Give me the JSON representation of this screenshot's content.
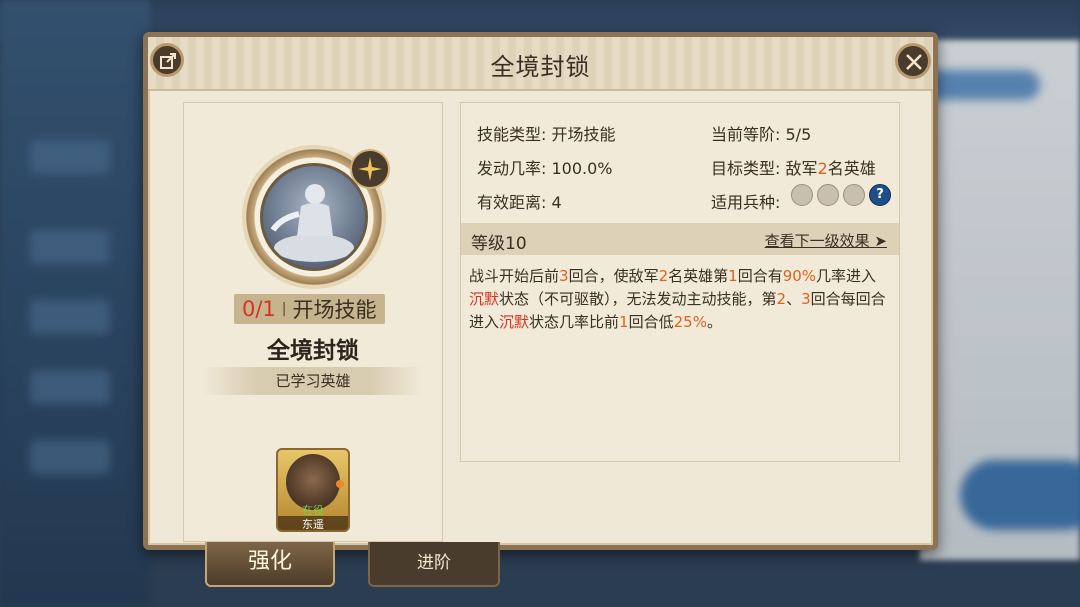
{
  "panel": {
    "title": "全境封锁"
  },
  "skill": {
    "count": "0/1",
    "type_tag": "开场技能",
    "name": "全境封锁",
    "learned_label": "已学习英雄"
  },
  "hero": {
    "status": "在役",
    "name": "东遥"
  },
  "attributes": {
    "skill_type_label": "技能类型:",
    "skill_type": "开场技能",
    "trigger_rate_label": "发动几率:",
    "trigger_rate": "100.0%",
    "range_label": "有效距离:",
    "range": "4",
    "current_rank_label": "当前等阶:",
    "current_rank": "5/5",
    "target_type_label": "目标类型:",
    "target_prefix": "敌军",
    "target_count": "2",
    "target_suffix": "名英雄",
    "troop_label": "适用兵种:"
  },
  "troop_icons": [
    "sword-icon",
    "bow-icon",
    "horse-icon",
    "question-icon"
  ],
  "level": {
    "label": "等级10",
    "next_link": "查看下一级效果"
  },
  "description": {
    "p1": "战斗开始后前",
    "n1": "3",
    "p2": "回合，使敌军",
    "n2": "2",
    "p3": "名英雄第",
    "n3": "1",
    "p4": "回合有",
    "n4": "90%",
    "p5": "几率进入",
    "s1": "沉默",
    "p6": "状态（不可驱散），无法发动主动技能，第",
    "n5": "2",
    "p7": "、",
    "n6": "3",
    "p8": "回合每回合进入",
    "s2": "沉默",
    "p9": "状态几率比前",
    "n7": "1",
    "p10": "回合低",
    "n8": "25%",
    "p11": "。"
  },
  "tabs": {
    "enhance": "强化",
    "advance": "进阶"
  },
  "colors": {
    "highlight_orange": "#e0621e",
    "highlight_red": "#d8321f",
    "frame": "#8c7354"
  }
}
